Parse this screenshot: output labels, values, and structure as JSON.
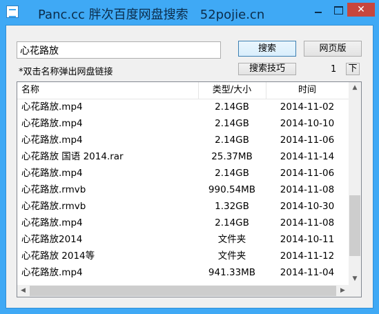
{
  "window": {
    "title": "Panc.cc 胖次百度网盘搜索   52pojie.cn",
    "minimize_icon": "minimize-icon",
    "maximize_icon": "maximize-icon",
    "close_symbol": "✕"
  },
  "search": {
    "query": "心花路放",
    "search_label": "搜索",
    "web_label": "网页版",
    "tips_label": "搜索技巧",
    "hint": "*双击名称弹出网盘链接",
    "page": "1",
    "next_label": "下"
  },
  "list": {
    "columns": [
      "名称",
      "类型/大小",
      "时间"
    ],
    "rows": [
      {
        "name": "心花路放.mp4",
        "size": "2.14GB",
        "time": "2014-11-02"
      },
      {
        "name": "心花路放.mp4",
        "size": "2.14GB",
        "time": "2014-10-10"
      },
      {
        "name": "心花路放.mp4",
        "size": "2.14GB",
        "time": "2014-11-06"
      },
      {
        "name": "心花路放 国语 2014.rar",
        "size": "25.37MB",
        "time": "2014-11-14"
      },
      {
        "name": "心花路放.mp4",
        "size": "2.14GB",
        "time": "2014-11-06"
      },
      {
        "name": "心花路放.rmvb",
        "size": "990.54MB",
        "time": "2014-11-08"
      },
      {
        "name": "心花路放.rmvb",
        "size": "1.32GB",
        "time": "2014-10-30"
      },
      {
        "name": "心花路放.mp4",
        "size": "2.14GB",
        "time": "2014-11-08"
      },
      {
        "name": "心花路放2014",
        "size": "文件夹",
        "time": "2014-10-11"
      },
      {
        "name": "心花路放 2014等",
        "size": "文件夹",
        "time": "2014-11-12"
      },
      {
        "name": "心花路放.mp4",
        "size": "941.33MB",
        "time": "2014-11-04"
      }
    ],
    "scroll_up": "▲",
    "scroll_down": "▼",
    "scroll_left": "◀",
    "scroll_right": "▶"
  },
  "colors": {
    "title_bar": "#3fa9f5",
    "close_button": "#c7463d"
  }
}
